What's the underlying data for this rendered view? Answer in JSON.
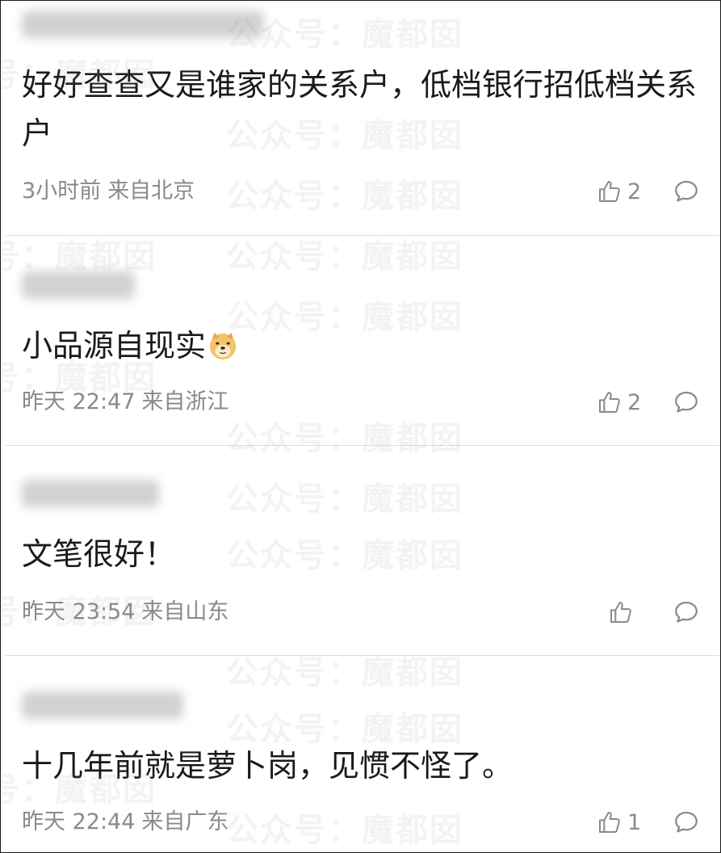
{
  "watermark_text": "公众号：魔都囡",
  "comments": [
    {
      "content": "好好查查又是谁家的关系户，低档银行招低档关系户",
      "time": "3小时前",
      "location": "来自北京",
      "likes": "2"
    },
    {
      "content": "小品源自现实",
      "emoji": "doge-emoji",
      "time": "昨天 22:47",
      "location": "来自浙江",
      "likes": "2"
    },
    {
      "content": "文笔很好！",
      "time": "昨天 23:54",
      "location": "来自山东",
      "likes": ""
    },
    {
      "content": "十几年前就是萝卜岗，见惯不怪了。",
      "time": "昨天 22:44",
      "location": "来自广东",
      "likes": "1"
    }
  ],
  "colors": {
    "content_text": "#1a1a1a",
    "meta_text": "#8a8a8a",
    "divider": "#dedede",
    "border": "#1a1a1a"
  },
  "icons": [
    "thumbs-up-icon",
    "reply-bubble-icon",
    "doge-emoji"
  ]
}
